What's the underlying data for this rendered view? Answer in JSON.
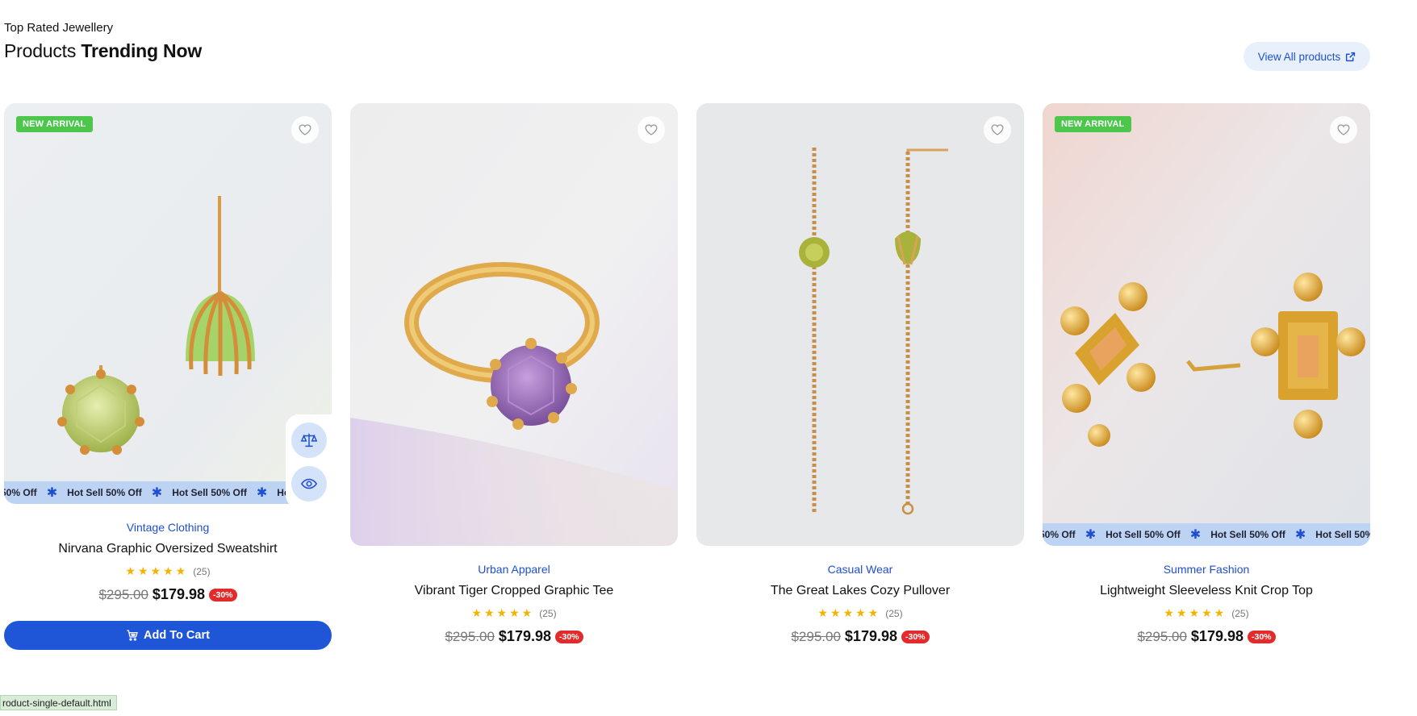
{
  "section": {
    "eyebrow": "Top Rated Jewellery",
    "title_regular": "Products ",
    "title_bold": "Trending Now",
    "view_all_label": "View All products"
  },
  "ticker_text": "Hot Sell 50% Off",
  "ticker_lead": "50% Off",
  "products": [
    {
      "badge": "NEW ARRIVAL",
      "category": "Vintage Clothing",
      "title": "Nirvana Graphic Oversized Sweatshirt",
      "rating": 5,
      "reviews": "(25)",
      "old_price": "$295.00",
      "price": "$179.98",
      "discount": "-30%",
      "cart_label": "Add To Cart",
      "image": "green-peridot-stud-earrings"
    },
    {
      "category": "Urban Apparel",
      "title": "Vibrant Tiger Cropped Graphic Tee",
      "rating": 5,
      "reviews": "(25)",
      "old_price": "$295.00",
      "price": "$179.98",
      "discount": "-30%",
      "image": "amethyst-gold-ring"
    },
    {
      "category": "Casual Wear",
      "title": "The Great Lakes Cozy Pullover",
      "rating": 5,
      "reviews": "(25)",
      "old_price": "$295.00",
      "price": "$179.98",
      "discount": "-30%",
      "image": "chain-drop-earrings"
    },
    {
      "badge": "NEW ARRIVAL",
      "category": "Summer Fashion",
      "title": "Lightweight Sleeveless Knit Crop Top",
      "rating": 5,
      "reviews": "(25)",
      "old_price": "$295.00",
      "price": "$179.98",
      "discount": "-30%",
      "image": "gold-citrine-studs"
    }
  ],
  "status_bar": "roduct-single-default.html",
  "colors": {
    "accent": "#1f56d8",
    "badge": "#4cc74c",
    "discount": "#e42b2b",
    "ticker": "#bcd3f3",
    "star": "#f5b300"
  }
}
